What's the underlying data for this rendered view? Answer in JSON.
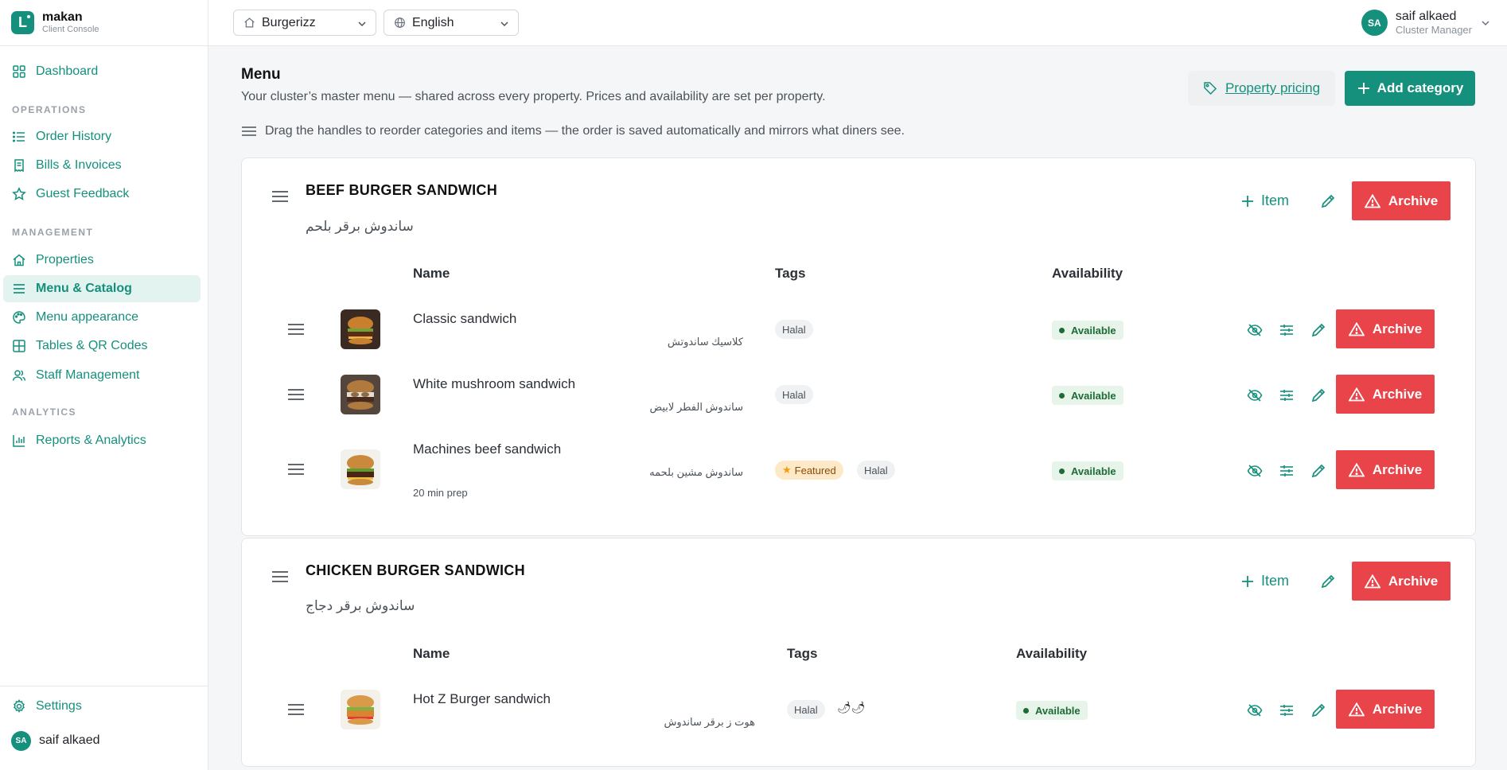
{
  "brand": {
    "name": "makan",
    "subtitle": "Client Console",
    "logo_letter": "L"
  },
  "sidebar": {
    "dashboard": "Dashboard",
    "sections": {
      "operations": "OPERATIONS",
      "management": "MANAGEMENT",
      "analytics": "ANALYTICS"
    },
    "items": [
      {
        "label": "Order History",
        "icon": "list-icon"
      },
      {
        "label": "Bills & Invoices",
        "icon": "receipt-icon"
      },
      {
        "label": "Guest Feedback",
        "icon": "star-icon"
      },
      {
        "label": "Properties",
        "icon": "home-icon"
      },
      {
        "label": "Menu & Catalog",
        "icon": "menu-icon",
        "active": true
      },
      {
        "label": "Menu appearance",
        "icon": "palette-icon"
      },
      {
        "label": "Tables & QR Codes",
        "icon": "grid-icon"
      },
      {
        "label": "Staff Management",
        "icon": "users-icon"
      },
      {
        "label": "Reports & Analytics",
        "icon": "chart-icon"
      }
    ],
    "settings": "Settings",
    "user_initials": "SA",
    "user_name": "saif alkaed"
  },
  "topbar": {
    "property": "Burgerizz",
    "language": "English",
    "user_initials": "SA",
    "user_name": "saif alkaed",
    "user_role": "Cluster Manager"
  },
  "page": {
    "title": "Menu",
    "subtitle": "Your cluster’s master menu — shared across every property. Prices and availability are set per property.",
    "hint": "Drag the handles to reorder categories and items — the order is saved automatically and mirrors what diners see.",
    "pricing_button": "Property pricing",
    "add_category_button": "Add category"
  },
  "labels": {
    "item_button": "Item",
    "archive": "Archive",
    "col_name": "Name",
    "col_tags": "Tags",
    "col_availability": "Availability"
  },
  "categories": [
    {
      "title": "BEEF BURGER SANDWICH",
      "title_ar": "ساندوش برقر بلحم",
      "items": [
        {
          "name": "Classic sandwich",
          "name_ar": "كلاسيك ساندوتش",
          "tags": [
            "Halal"
          ],
          "availability": "Available"
        },
        {
          "name": "White mushroom sandwich",
          "name_ar": "ساندوش الفطر لابيض",
          "tags": [
            "Halal"
          ],
          "availability": "Available"
        },
        {
          "name": "Machines beef sandwich",
          "name_ar": "ساندوش مشين بلحمه",
          "meta": "20 min prep",
          "featured": "Featured",
          "tags": [
            "Halal"
          ],
          "availability": "Available"
        }
      ]
    },
    {
      "title": "CHICKEN BURGER SANDWICH",
      "title_ar": "ساندوش برقر دجاج",
      "items": [
        {
          "name": "Hot Z Burger sandwich",
          "name_ar": "هوت ز برقر ساندوش",
          "tags": [
            "Halal"
          ],
          "spice": "🌶🌶",
          "availability": "Available"
        }
      ]
    }
  ],
  "colors": {
    "accent": "#15907d",
    "danger": "#e9444a",
    "available_bg": "#e6f4ea"
  }
}
